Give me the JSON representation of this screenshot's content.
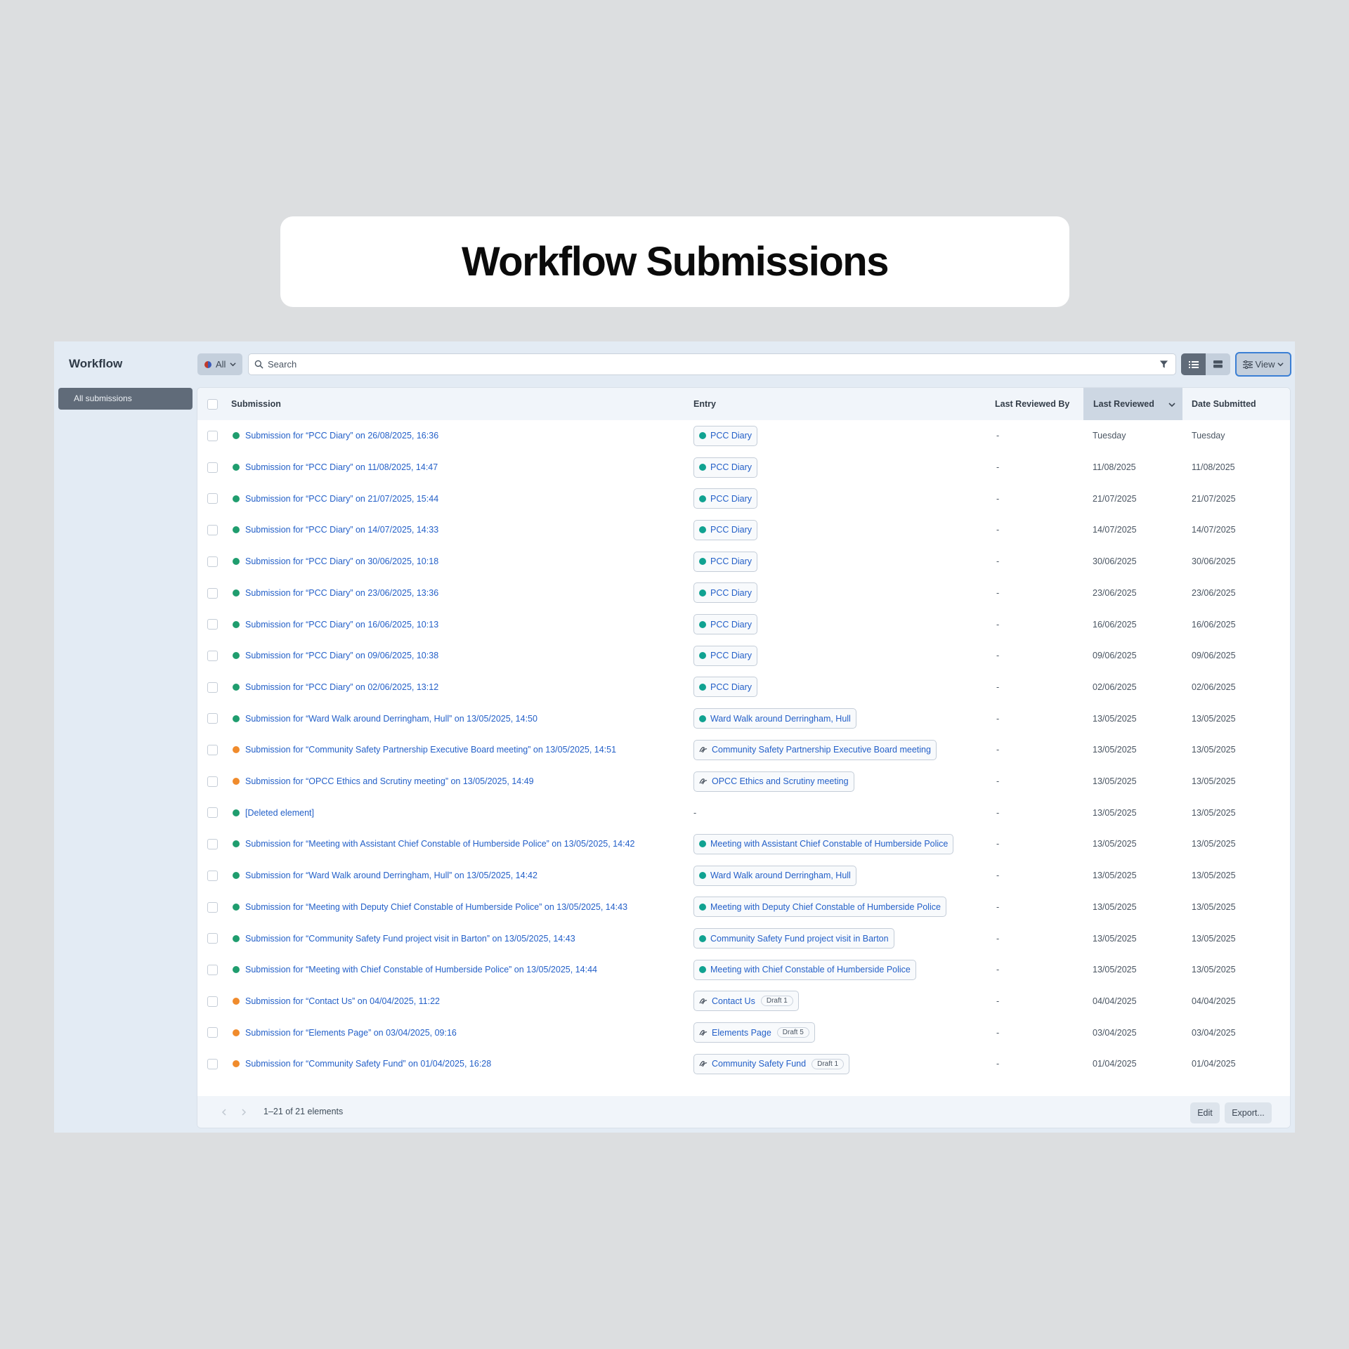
{
  "page_title": "Workflow Submissions",
  "app": {
    "title": "Workflow",
    "sidebar": {
      "items": [
        {
          "label": "All submissions"
        }
      ]
    },
    "toolbar": {
      "status_filter": "All",
      "search_placeholder": "Search",
      "view_label": "View"
    },
    "table": {
      "columns": {
        "submission": "Submission",
        "entry": "Entry",
        "last_reviewed_by": "Last Reviewed By",
        "last_reviewed": "Last Reviewed",
        "date_submitted": "Date Submitted"
      },
      "sorted_column": "Last Reviewed",
      "rows": [
        {
          "status": "green",
          "submission": "Submission for “PCC Diary” on 26/08/2025, 16:36",
          "entry": "PCC Diary",
          "entry_icon": "dot",
          "draft": "",
          "reviewed_by": "-",
          "last_reviewed": "Tuesday",
          "date_submitted": "Tuesday"
        },
        {
          "status": "green",
          "submission": "Submission for “PCC Diary” on 11/08/2025, 14:47",
          "entry": "PCC Diary",
          "entry_icon": "dot",
          "draft": "",
          "reviewed_by": "-",
          "last_reviewed": "11/08/2025",
          "date_submitted": "11/08/2025"
        },
        {
          "status": "green",
          "submission": "Submission for “PCC Diary” on 21/07/2025, 15:44",
          "entry": "PCC Diary",
          "entry_icon": "dot",
          "draft": "",
          "reviewed_by": "-",
          "last_reviewed": "21/07/2025",
          "date_submitted": "21/07/2025"
        },
        {
          "status": "green",
          "submission": "Submission for “PCC Diary” on 14/07/2025, 14:33",
          "entry": "PCC Diary",
          "entry_icon": "dot",
          "draft": "",
          "reviewed_by": "-",
          "last_reviewed": "14/07/2025",
          "date_submitted": "14/07/2025"
        },
        {
          "status": "green",
          "submission": "Submission for “PCC Diary” on 30/06/2025, 10:18",
          "entry": "PCC Diary",
          "entry_icon": "dot",
          "draft": "",
          "reviewed_by": "-",
          "last_reviewed": "30/06/2025",
          "date_submitted": "30/06/2025"
        },
        {
          "status": "green",
          "submission": "Submission for “PCC Diary” on 23/06/2025, 13:36",
          "entry": "PCC Diary",
          "entry_icon": "dot",
          "draft": "",
          "reviewed_by": "-",
          "last_reviewed": "23/06/2025",
          "date_submitted": "23/06/2025"
        },
        {
          "status": "green",
          "submission": "Submission for “PCC Diary” on 16/06/2025, 10:13",
          "entry": "PCC Diary",
          "entry_icon": "dot",
          "draft": "",
          "reviewed_by": "-",
          "last_reviewed": "16/06/2025",
          "date_submitted": "16/06/2025"
        },
        {
          "status": "green",
          "submission": "Submission for “PCC Diary” on 09/06/2025, 10:38",
          "entry": "PCC Diary",
          "entry_icon": "dot",
          "draft": "",
          "reviewed_by": "-",
          "last_reviewed": "09/06/2025",
          "date_submitted": "09/06/2025"
        },
        {
          "status": "green",
          "submission": "Submission for “PCC Diary” on 02/06/2025, 13:12",
          "entry": "PCC Diary",
          "entry_icon": "dot",
          "draft": "",
          "reviewed_by": "-",
          "last_reviewed": "02/06/2025",
          "date_submitted": "02/06/2025"
        },
        {
          "status": "green",
          "submission": "Submission for “Ward Walk around Derringham, Hull” on 13/05/2025, 14:50",
          "entry": "Ward Walk around Derringham, Hull",
          "entry_icon": "dot",
          "draft": "",
          "reviewed_by": "-",
          "last_reviewed": "13/05/2025",
          "date_submitted": "13/05/2025"
        },
        {
          "status": "orange",
          "submission": "Submission for “Community Safety Partnership Executive Board meeting” on 13/05/2025, 14:51",
          "entry": "Community Safety Partnership Executive Board meeting",
          "entry_icon": "draft",
          "draft": "",
          "reviewed_by": "-",
          "last_reviewed": "13/05/2025",
          "date_submitted": "13/05/2025"
        },
        {
          "status": "orange",
          "submission": "Submission for “OPCC Ethics and Scrutiny meeting” on 13/05/2025, 14:49",
          "entry": "OPCC Ethics and Scrutiny meeting",
          "entry_icon": "draft",
          "draft": "",
          "reviewed_by": "-",
          "last_reviewed": "13/05/2025",
          "date_submitted": "13/05/2025"
        },
        {
          "status": "green",
          "submission": "[Deleted element]",
          "entry": "-",
          "entry_icon": "none",
          "draft": "",
          "reviewed_by": "-",
          "last_reviewed": "13/05/2025",
          "date_submitted": "13/05/2025"
        },
        {
          "status": "green",
          "submission": "Submission for “Meeting with Assistant Chief Constable of Humberside Police” on 13/05/2025, 14:42",
          "entry": "Meeting with Assistant Chief Constable of Humberside Police",
          "entry_icon": "dot",
          "draft": "",
          "reviewed_by": "-",
          "last_reviewed": "13/05/2025",
          "date_submitted": "13/05/2025"
        },
        {
          "status": "green",
          "submission": "Submission for “Ward Walk around Derringham, Hull” on 13/05/2025, 14:42",
          "entry": "Ward Walk around Derringham, Hull",
          "entry_icon": "dot",
          "draft": "",
          "reviewed_by": "-",
          "last_reviewed": "13/05/2025",
          "date_submitted": "13/05/2025"
        },
        {
          "status": "green",
          "submission": "Submission for “Meeting with Deputy Chief Constable of Humberside Police” on 13/05/2025, 14:43",
          "entry": "Meeting with Deputy Chief Constable of Humberside Police",
          "entry_icon": "dot",
          "draft": "",
          "reviewed_by": "-",
          "last_reviewed": "13/05/2025",
          "date_submitted": "13/05/2025"
        },
        {
          "status": "green",
          "submission": "Submission for “Community Safety Fund project visit in Barton” on 13/05/2025, 14:43",
          "entry": "Community Safety Fund project visit in Barton",
          "entry_icon": "dot",
          "draft": "",
          "reviewed_by": "-",
          "last_reviewed": "13/05/2025",
          "date_submitted": "13/05/2025"
        },
        {
          "status": "green",
          "submission": "Submission for “Meeting with Chief Constable of Humberside Police” on 13/05/2025, 14:44",
          "entry": "Meeting with Chief Constable of Humberside Police",
          "entry_icon": "dot",
          "draft": "",
          "reviewed_by": "-",
          "last_reviewed": "13/05/2025",
          "date_submitted": "13/05/2025"
        },
        {
          "status": "orange",
          "submission": "Submission for “Contact Us” on 04/04/2025, 11:22",
          "entry": "Contact Us",
          "entry_icon": "draft",
          "draft": "Draft 1",
          "reviewed_by": "-",
          "last_reviewed": "04/04/2025",
          "date_submitted": "04/04/2025"
        },
        {
          "status": "orange",
          "submission": "Submission for “Elements Page” on 03/04/2025, 09:16",
          "entry": "Elements Page",
          "entry_icon": "draft",
          "draft": "Draft 5",
          "reviewed_by": "-",
          "last_reviewed": "03/04/2025",
          "date_submitted": "03/04/2025"
        },
        {
          "status": "orange",
          "submission": "Submission for “Community Safety Fund” on 01/04/2025, 16:28",
          "entry": "Community Safety Fund",
          "entry_icon": "draft",
          "draft": "Draft 1",
          "reviewed_by": "-",
          "last_reviewed": "01/04/2025",
          "date_submitted": "01/04/2025"
        }
      ]
    },
    "footer": {
      "count": "1–21 of 21 elements",
      "prev_icon": "chevron-left-icon",
      "next_icon": "chevron-right-icon",
      "edit_label": "Edit",
      "export_label": "Export..."
    }
  },
  "colors": {
    "status_green": "#1f9d6e",
    "status_orange": "#f08b2c",
    "entry_dot": "#10a291",
    "link": "#2460c8",
    "focus": "#3b7fd4"
  }
}
